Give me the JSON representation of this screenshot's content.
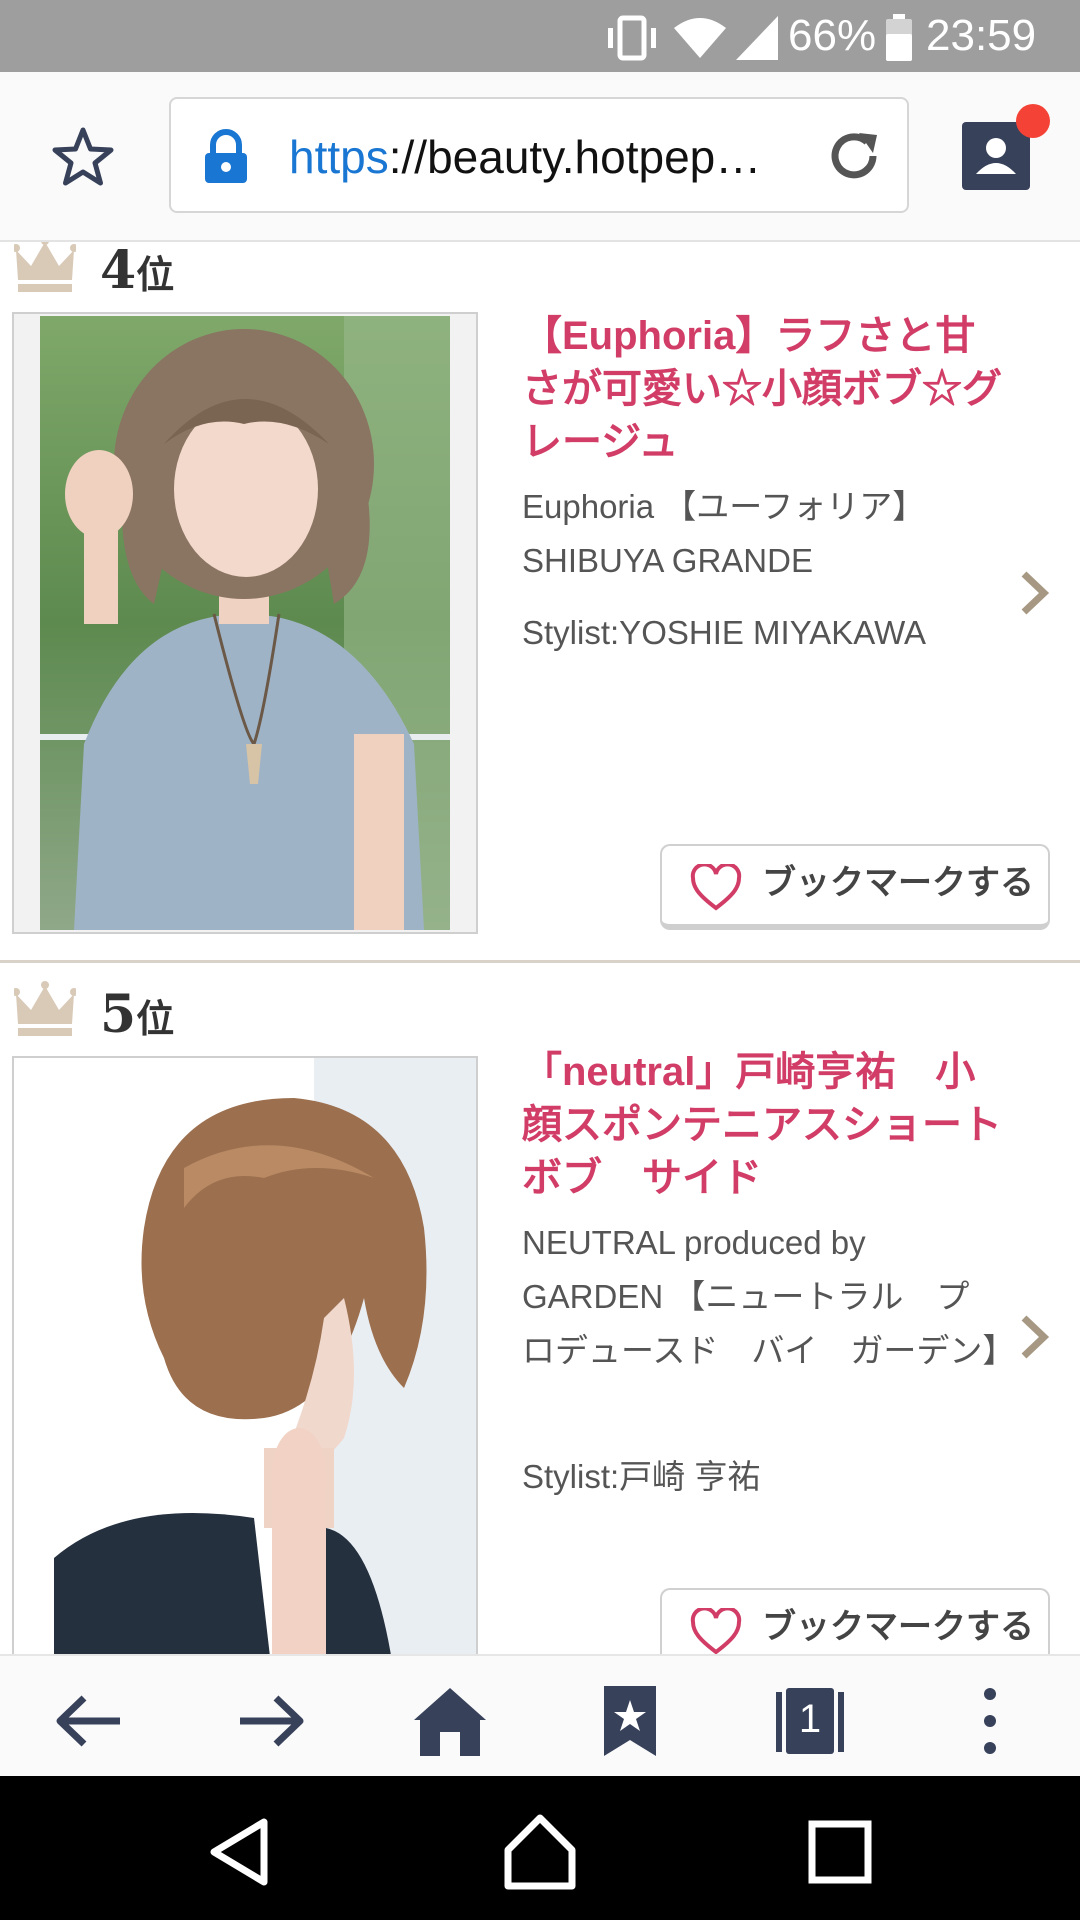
{
  "status_bar": {
    "battery_percent": "66%",
    "time": "23:59",
    "icons": [
      "vibrate-icon",
      "wifi-icon",
      "signal-icon",
      "battery-icon"
    ]
  },
  "browser": {
    "url_scheme": "https",
    "url_rest": "://beauty.hotpep…",
    "icons": [
      "star-icon",
      "lock-icon",
      "reload-icon",
      "account-icon"
    ]
  },
  "items": [
    {
      "rank": "4",
      "rank_suffix": "位",
      "title": "【Euphoria】ラフさと甘さが可愛い☆小顔ボブ☆グレージュ",
      "salon": "Euphoria 【ユーフォリア】SHIBUYA GRANDE",
      "stylist": "Stylist:YOSHIE MIYAKAWA",
      "bookmark_label": "ブックマークする"
    },
    {
      "rank": "5",
      "rank_suffix": "位",
      "title": "「neutral」戸崎亨祐　小顔スポンテニアスショートボブ　サイド",
      "salon": "NEUTRAL produced by GARDEN 【ニュートラル　プロデュースド　バイ　ガーデン】",
      "stylist": "Stylist:戸崎 亨祐",
      "bookmark_label": "ブックマークする"
    }
  ],
  "bottom_bar": {
    "tab_count": "1",
    "icons": [
      "back-icon",
      "forward-icon",
      "home-icon",
      "bookmarks-icon",
      "tabs-icon",
      "more-icon"
    ]
  },
  "colors": {
    "title_pink": "#d13d66",
    "status_bar": "#9e9e9e",
    "toolbar_icon": "#37415a",
    "notification_dot": "#f44336",
    "link_blue": "#1976d2"
  }
}
